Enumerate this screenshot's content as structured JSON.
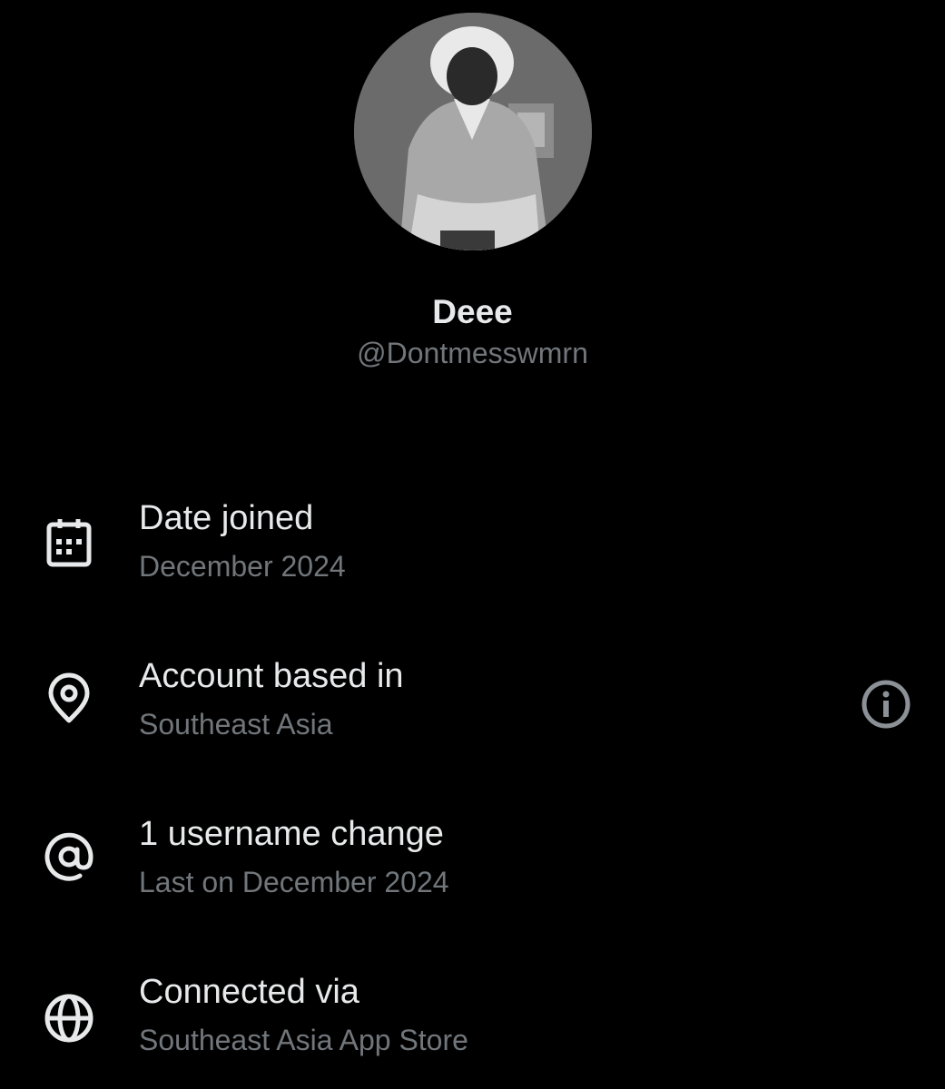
{
  "profile": {
    "display_name": "Deee",
    "handle": "@Dontmesswmrn",
    "avatar_icon": "profile-photo"
  },
  "rows": [
    {
      "icon": "calendar-icon",
      "title": "Date joined",
      "subtitle": "December 2024"
    },
    {
      "icon": "location-pin-icon",
      "title": "Account based in",
      "subtitle": "Southeast Asia",
      "action_icon": "info-icon"
    },
    {
      "icon": "at-sign-icon",
      "title": "1 username change",
      "subtitle": "Last on December 2024"
    },
    {
      "icon": "globe-icon",
      "title": "Connected via",
      "subtitle": "Southeast Asia App Store"
    }
  ],
  "colors": {
    "background": "#000000",
    "primary_text": "#e7e9ea",
    "secondary_text": "#71767b",
    "info_icon": "#8b9196"
  }
}
